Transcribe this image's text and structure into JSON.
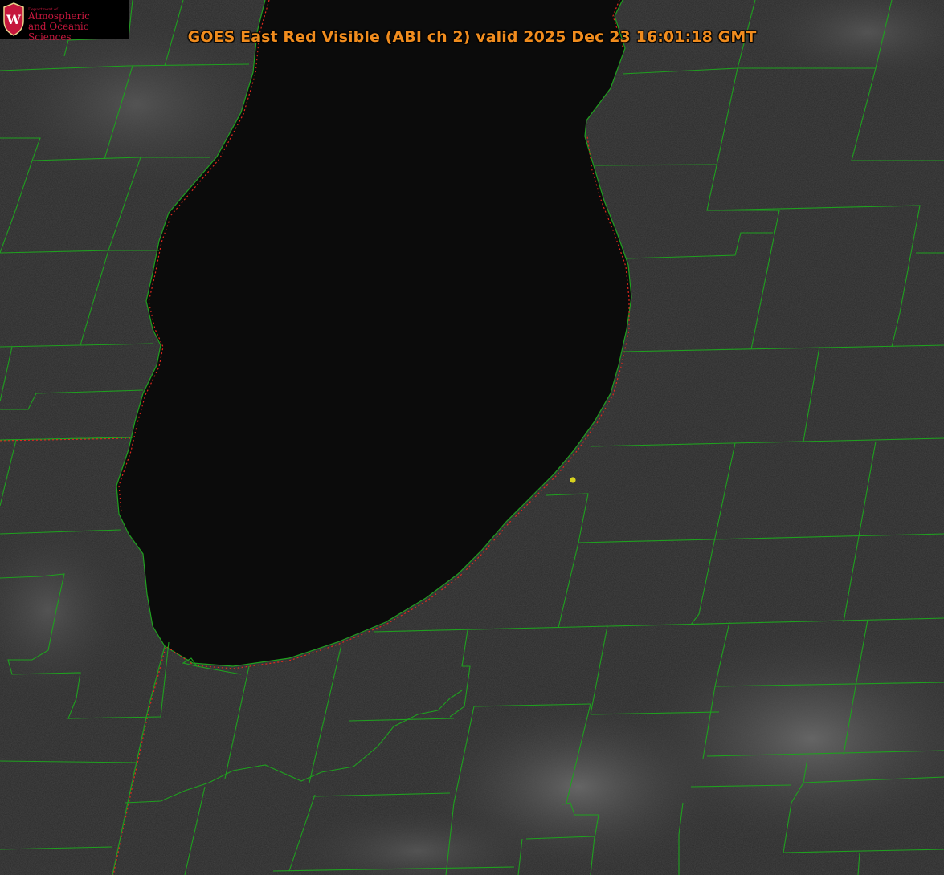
{
  "title": "GOES East Red Visible (ABI ch 2) valid 2025 Dec 23 16:01:18 GMT",
  "logo": {
    "department": "Department of",
    "line1": "Atmospheric",
    "line2": "and Oceanic Sciences",
    "crest_letter": "W",
    "crest_color": "#c5173d"
  },
  "colors": {
    "title": "#f08c1e",
    "county_lines": "#1fa01f",
    "state_lines": "#e0281e",
    "marker": "#d7d21e",
    "lake": "#0b0b0b",
    "land": "#2a2a2a"
  },
  "marker": {
    "name": "station-marker"
  }
}
